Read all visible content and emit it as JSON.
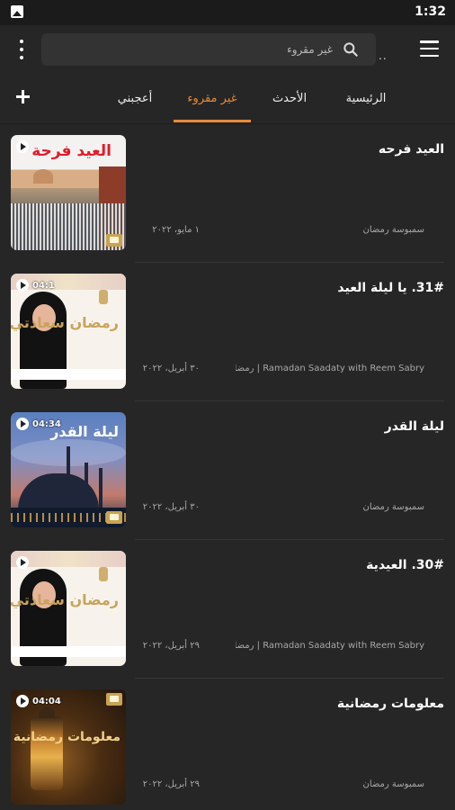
{
  "status_bar": {
    "time": "1:32"
  },
  "toolbar": {
    "search_placeholder": "غير مقروء",
    "dots": ".."
  },
  "tabs": [
    {
      "label": "أعجبني",
      "active": false
    },
    {
      "label": "غير مقروء",
      "active": true
    },
    {
      "label": "الأحدث",
      "active": false
    },
    {
      "label": "الرئيسية",
      "active": false
    }
  ],
  "colors": {
    "accent": "#e68a3a",
    "background": "#262626"
  },
  "episodes": [
    {
      "title": "العيد فرحه",
      "author": "سمبوسة رمضان",
      "date": "١ مايو، ٢٠٢٢",
      "duration": "",
      "thumb_text": "العيد فرحة"
    },
    {
      "title": "31#. يا ليلة العيد",
      "author": "Ramadan Saadaty with Reem Sabry | رمضان سعا...",
      "date": "٣٠ أبريل، ٢٠٢٢",
      "duration": "04:1",
      "thumb_text": "رمضان سعادتي"
    },
    {
      "title": "ليلة القدر",
      "author": "سمبوسة رمضان",
      "date": "٣٠ أبريل، ٢٠٢٢",
      "duration": "04:34",
      "thumb_text": "ليلة القدر"
    },
    {
      "title": "30#. العيدية",
      "author": "Ramadan Saadaty with Reem Sabry | رمضان سعا...",
      "date": "٢٩ أبريل، ٢٠٢٢",
      "duration": "",
      "thumb_text": "رمضان سعادتي"
    },
    {
      "title": "معلومات رمضانية",
      "author": "سمبوسة رمضان",
      "date": "٢٩ أبريل، ٢٠٢٢",
      "duration": "04:04",
      "thumb_text": "معلومات رمضانية"
    }
  ]
}
